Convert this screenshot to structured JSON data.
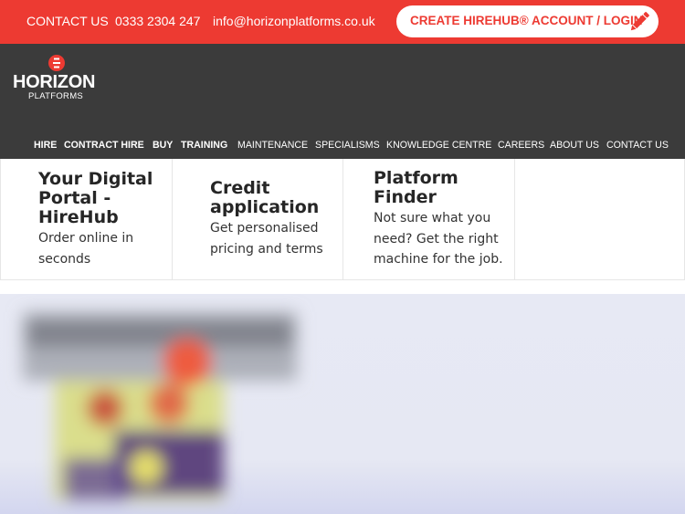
{
  "topbar": {
    "contact_label": "CONTACT US",
    "phone": "0333 2304 247",
    "email": "info@horizonplatforms.co.uk",
    "cta_label": "CREATE HIREHUB® ACCOUNT / LOGIN",
    "cta_icon": "pencil-icon"
  },
  "logo": {
    "name": "HORIZON",
    "sub": "PLATFORMS"
  },
  "nav": {
    "items": [
      "HIRE",
      "CONTRACT HIRE",
      "BUY",
      "TRAINING",
      "MAINTENANCE",
      "SPECIALISMS",
      "KNOWLEDGE CENTRE",
      "CAREERS",
      "ABOUT US",
      "CONTACT US"
    ]
  },
  "cards": [
    {
      "title": [
        "Your Digital",
        "Portal -",
        "HireHub"
      ],
      "desc": [
        "Order online in",
        "seconds"
      ]
    },
    {
      "title": [
        "Credit",
        "application"
      ],
      "desc": [
        "Get personalised",
        "pricing and terms"
      ]
    },
    {
      "title": [
        "Platform",
        "Finder"
      ],
      "desc": [
        "Not sure what you",
        "need? Get the right",
        "machine for the job."
      ]
    }
  ],
  "colors": {
    "brand_red": "#ed3a32",
    "header_dark": "#3b3b3b",
    "hero_bg": "#e7e9f4"
  }
}
